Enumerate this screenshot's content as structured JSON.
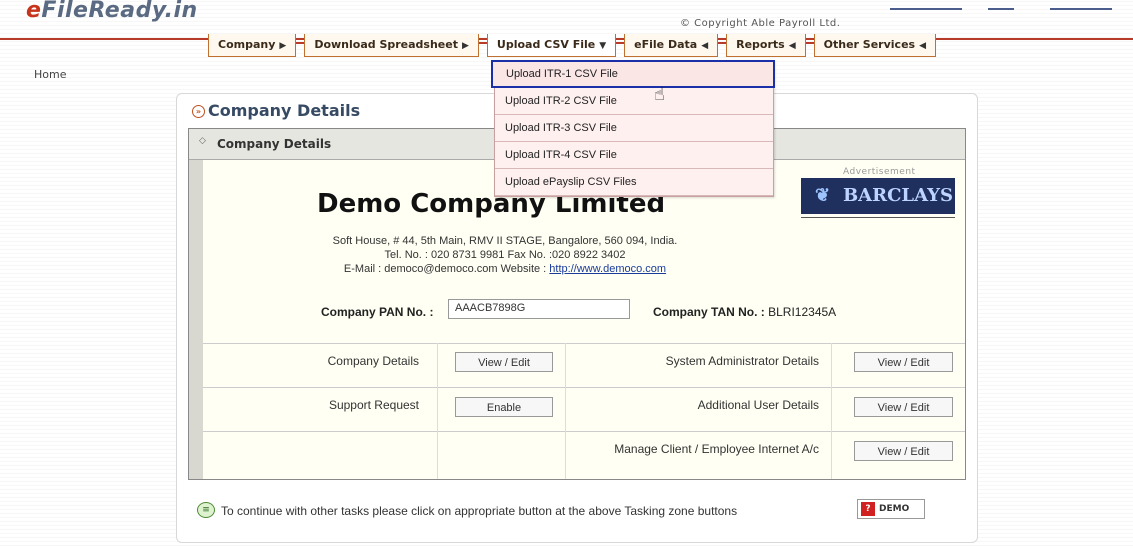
{
  "logo": {
    "e": "e",
    "rest": "FileReady.in"
  },
  "copyright": "© Copyright Able Payroll Ltd.",
  "nav": [
    {
      "label": "Company",
      "arrow": "▶"
    },
    {
      "label": "Download Spreadsheet",
      "arrow": "▶"
    },
    {
      "label": "Upload CSV File",
      "arrow": "▼"
    },
    {
      "label": "eFile Data",
      "arrow": "◀"
    },
    {
      "label": "Reports",
      "arrow": "◀"
    },
    {
      "label": "Other Services",
      "arrow": "◀"
    }
  ],
  "dropdown": [
    "Upload ITR-1 CSV File",
    "Upload ITR-2 CSV File",
    "Upload ITR-3 CSV File",
    "Upload ITR-4 CSV File",
    "Upload ePayslip CSV Files"
  ],
  "breadcrumb": "Home",
  "panel": {
    "title": "Company Details",
    "inner_title": "Company Details"
  },
  "company": {
    "name": "Demo Company Limited",
    "address": "Soft House, # 44, 5th Main, RMV II STAGE, Bangalore, 560 094, India.",
    "phone": "Tel. No. : 020 8731 9981   Fax No. :020 8922 3402",
    "email_prefix": "E-Mail : democo@democo.com  Website : ",
    "website": "http://www.democo.com",
    "pan_label": "Company PAN No. :",
    "pan_value": "AAACB7898G",
    "tan_label": "Company TAN No. :",
    "tan_value": "BLRI12345A"
  },
  "ad": {
    "label": "Advertisement",
    "brand": "BARCLAYS"
  },
  "rows": [
    {
      "left_label": "Company Details",
      "left_btn": "View / Edit",
      "right_label": "System Administrator Details",
      "right_btn": "View / Edit"
    },
    {
      "left_label": "Support Request",
      "left_btn": "Enable",
      "right_label": "Additional User Details",
      "right_btn": "View / Edit"
    },
    {
      "left_label": "",
      "left_btn": "",
      "right_label": "Manage Client / Employee Internet A/c",
      "right_btn": "View / Edit"
    }
  ],
  "footer": {
    "message": "To continue with other tasks please click on appropriate button at the above Tasking zone buttons",
    "badge": "DEMO",
    "badge_q": "?"
  }
}
